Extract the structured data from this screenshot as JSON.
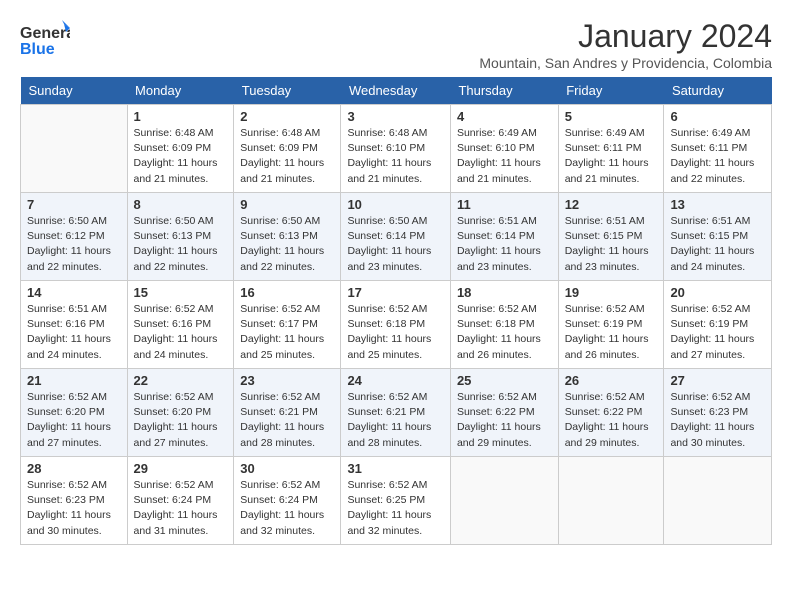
{
  "logo": {
    "general": "General",
    "blue": "Blue"
  },
  "title": "January 2024",
  "subtitle": "Mountain, San Andres y Providencia, Colombia",
  "headers": [
    "Sunday",
    "Monday",
    "Tuesday",
    "Wednesday",
    "Thursday",
    "Friday",
    "Saturday"
  ],
  "weeks": [
    [
      {
        "num": "",
        "info": ""
      },
      {
        "num": "1",
        "info": "Sunrise: 6:48 AM\nSunset: 6:09 PM\nDaylight: 11 hours\nand 21 minutes."
      },
      {
        "num": "2",
        "info": "Sunrise: 6:48 AM\nSunset: 6:09 PM\nDaylight: 11 hours\nand 21 minutes."
      },
      {
        "num": "3",
        "info": "Sunrise: 6:48 AM\nSunset: 6:10 PM\nDaylight: 11 hours\nand 21 minutes."
      },
      {
        "num": "4",
        "info": "Sunrise: 6:49 AM\nSunset: 6:10 PM\nDaylight: 11 hours\nand 21 minutes."
      },
      {
        "num": "5",
        "info": "Sunrise: 6:49 AM\nSunset: 6:11 PM\nDaylight: 11 hours\nand 21 minutes."
      },
      {
        "num": "6",
        "info": "Sunrise: 6:49 AM\nSunset: 6:11 PM\nDaylight: 11 hours\nand 22 minutes."
      }
    ],
    [
      {
        "num": "7",
        "info": "Sunrise: 6:50 AM\nSunset: 6:12 PM\nDaylight: 11 hours\nand 22 minutes."
      },
      {
        "num": "8",
        "info": "Sunrise: 6:50 AM\nSunset: 6:13 PM\nDaylight: 11 hours\nand 22 minutes."
      },
      {
        "num": "9",
        "info": "Sunrise: 6:50 AM\nSunset: 6:13 PM\nDaylight: 11 hours\nand 22 minutes."
      },
      {
        "num": "10",
        "info": "Sunrise: 6:50 AM\nSunset: 6:14 PM\nDaylight: 11 hours\nand 23 minutes."
      },
      {
        "num": "11",
        "info": "Sunrise: 6:51 AM\nSunset: 6:14 PM\nDaylight: 11 hours\nand 23 minutes."
      },
      {
        "num": "12",
        "info": "Sunrise: 6:51 AM\nSunset: 6:15 PM\nDaylight: 11 hours\nand 23 minutes."
      },
      {
        "num": "13",
        "info": "Sunrise: 6:51 AM\nSunset: 6:15 PM\nDaylight: 11 hours\nand 24 minutes."
      }
    ],
    [
      {
        "num": "14",
        "info": "Sunrise: 6:51 AM\nSunset: 6:16 PM\nDaylight: 11 hours\nand 24 minutes."
      },
      {
        "num": "15",
        "info": "Sunrise: 6:52 AM\nSunset: 6:16 PM\nDaylight: 11 hours\nand 24 minutes."
      },
      {
        "num": "16",
        "info": "Sunrise: 6:52 AM\nSunset: 6:17 PM\nDaylight: 11 hours\nand 25 minutes."
      },
      {
        "num": "17",
        "info": "Sunrise: 6:52 AM\nSunset: 6:18 PM\nDaylight: 11 hours\nand 25 minutes."
      },
      {
        "num": "18",
        "info": "Sunrise: 6:52 AM\nSunset: 6:18 PM\nDaylight: 11 hours\nand 26 minutes."
      },
      {
        "num": "19",
        "info": "Sunrise: 6:52 AM\nSunset: 6:19 PM\nDaylight: 11 hours\nand 26 minutes."
      },
      {
        "num": "20",
        "info": "Sunrise: 6:52 AM\nSunset: 6:19 PM\nDaylight: 11 hours\nand 27 minutes."
      }
    ],
    [
      {
        "num": "21",
        "info": "Sunrise: 6:52 AM\nSunset: 6:20 PM\nDaylight: 11 hours\nand 27 minutes."
      },
      {
        "num": "22",
        "info": "Sunrise: 6:52 AM\nSunset: 6:20 PM\nDaylight: 11 hours\nand 27 minutes."
      },
      {
        "num": "23",
        "info": "Sunrise: 6:52 AM\nSunset: 6:21 PM\nDaylight: 11 hours\nand 28 minutes."
      },
      {
        "num": "24",
        "info": "Sunrise: 6:52 AM\nSunset: 6:21 PM\nDaylight: 11 hours\nand 28 minutes."
      },
      {
        "num": "25",
        "info": "Sunrise: 6:52 AM\nSunset: 6:22 PM\nDaylight: 11 hours\nand 29 minutes."
      },
      {
        "num": "26",
        "info": "Sunrise: 6:52 AM\nSunset: 6:22 PM\nDaylight: 11 hours\nand 29 minutes."
      },
      {
        "num": "27",
        "info": "Sunrise: 6:52 AM\nSunset: 6:23 PM\nDaylight: 11 hours\nand 30 minutes."
      }
    ],
    [
      {
        "num": "28",
        "info": "Sunrise: 6:52 AM\nSunset: 6:23 PM\nDaylight: 11 hours\nand 30 minutes."
      },
      {
        "num": "29",
        "info": "Sunrise: 6:52 AM\nSunset: 6:24 PM\nDaylight: 11 hours\nand 31 minutes."
      },
      {
        "num": "30",
        "info": "Sunrise: 6:52 AM\nSunset: 6:24 PM\nDaylight: 11 hours\nand 32 minutes."
      },
      {
        "num": "31",
        "info": "Sunrise: 6:52 AM\nSunset: 6:25 PM\nDaylight: 11 hours\nand 32 minutes."
      },
      {
        "num": "",
        "info": ""
      },
      {
        "num": "",
        "info": ""
      },
      {
        "num": "",
        "info": ""
      }
    ]
  ]
}
